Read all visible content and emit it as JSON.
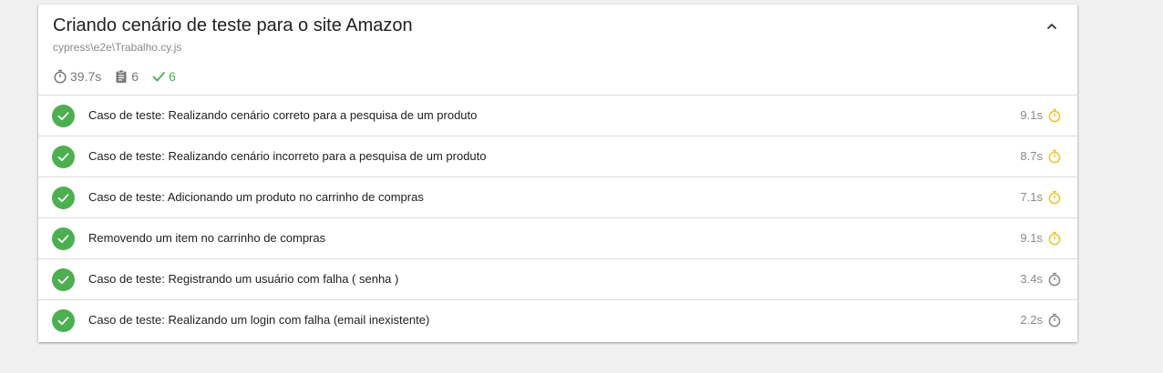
{
  "suite": {
    "title": "Criando cenário de teste para o site Amazon",
    "file": "cypress\\e2e\\Trabalho.cy.js",
    "collapse_icon": "chevron-up-icon",
    "stats": {
      "duration": "39.7s",
      "tests": "6",
      "passes": "6"
    }
  },
  "colors": {
    "pass": "#4caf50",
    "slow": "#f1c232",
    "fast": "#8a8a8a",
    "background": "#f0f0f0"
  },
  "tests": [
    {
      "title": "Caso de teste: Realizando cenário correto para a pesquisa de um produto",
      "duration": "9.1s",
      "state": "passed",
      "speed": "slow"
    },
    {
      "title": "Caso de teste: Realizando cenário incorreto para a pesquisa de um produto",
      "duration": "8.7s",
      "state": "passed",
      "speed": "slow"
    },
    {
      "title": "Caso de teste: Adicionando um produto no carrinho de compras",
      "duration": "7.1s",
      "state": "passed",
      "speed": "slow"
    },
    {
      "title": "Removendo um item no carrinho de compras",
      "duration": "9.1s",
      "state": "passed",
      "speed": "slow"
    },
    {
      "title": "Caso de teste: Registrando um usuário com falha ( senha )",
      "duration": "3.4s",
      "state": "passed",
      "speed": "fast"
    },
    {
      "title": "Caso de teste: Realizando um login com falha (email inexistente)",
      "duration": "2.2s",
      "state": "passed",
      "speed": "fast"
    }
  ]
}
